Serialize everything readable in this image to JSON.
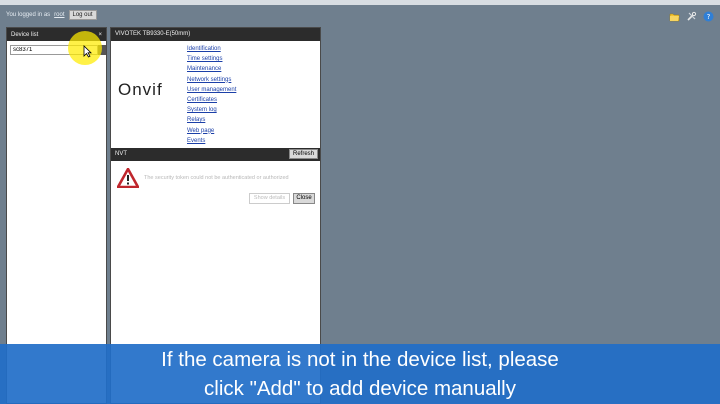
{
  "login": {
    "text": "You logged in as",
    "user": "root",
    "logout_label": "Log out"
  },
  "top_icons": [
    "folder-icon",
    "tools-icon",
    "help-icon"
  ],
  "device_list": {
    "title": "Device list",
    "close_glyph": "×",
    "search_value": "sc8371"
  },
  "device_detail": {
    "title": "VIVOTEK TB9330-E(50mm)",
    "logo": "Onvif",
    "menu": [
      "Identification",
      "Time settings",
      "Maintenance",
      "Network settings",
      "User management",
      "Certificates",
      "System log",
      "Relays",
      "Web page",
      "Events"
    ]
  },
  "nvt": {
    "title": "NVT",
    "refresh_label": "Refresh",
    "warning": "The security token could not be authenticated or authorized",
    "details_label": "Show details",
    "close_label": "Close"
  },
  "caption": {
    "line1": "If the camera is not in the device list, please",
    "line2": "click \"Add\" to add device manually"
  },
  "colors": {
    "desktop": "#6f7f8e",
    "header": "#2c2c2c",
    "link": "#1b3fa8",
    "caption_bg": "#216ec8",
    "warning_red": "#c0262d",
    "highlight": "#ffec00"
  }
}
